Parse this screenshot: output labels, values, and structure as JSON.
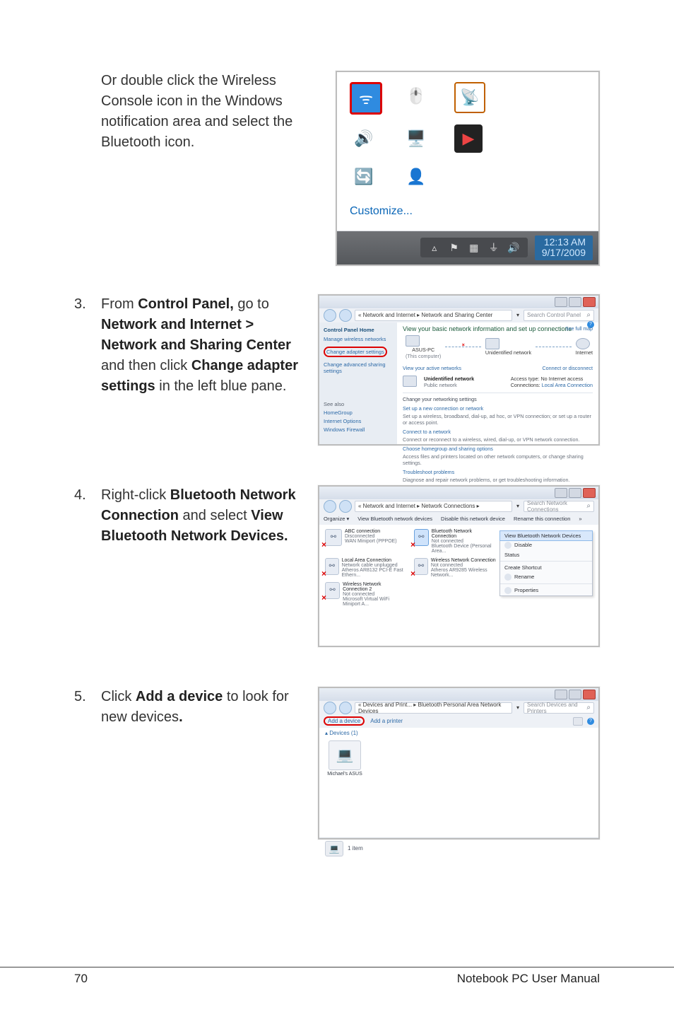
{
  "intro": {
    "text": "Or double click the Wireless Console icon in the Windows notification area and select the Bluetooth icon."
  },
  "steps": {
    "s3": {
      "num": "3.",
      "pre": "From ",
      "b1": "Control Panel,",
      "t1": " go to ",
      "b2": "Network and Internet > Network and Sharing Center",
      "t2": " and then click ",
      "b3": "Change adapter settings",
      "t3": " in the left blue pane."
    },
    "s4": {
      "num": "4.",
      "t0": "Right-click ",
      "b1": "Bluetooth Network Connection",
      "t1": " and select ",
      "b2": "View Bluetooth Network Devices."
    },
    "s5": {
      "num": "5.",
      "t0": "Click ",
      "b1": "Add a device",
      "t1": " to look for new devices",
      "b2": "."
    }
  },
  "shot1": {
    "customize": "Customize...",
    "time": "12:13 AM",
    "date": "9/17/2009",
    "icons": {
      "wifi": "wifi-icon",
      "mouse": "mouse-icon",
      "antenna": "antenna-icon",
      "speaker": "speaker-icon",
      "monitor": "monitor-icon",
      "video": "video-icon",
      "refresh": "refresh-icon",
      "user": "user-icon"
    },
    "tray": {
      "up": "▵",
      "flag": "⚑",
      "net": "▦",
      "bars": "⏚",
      "vol": "🔊"
    }
  },
  "shot2": {
    "breadcrumb": "« Network and Internet ▸ Network and Sharing Center",
    "search_ph": "Search Control Panel",
    "side_header": "Control Panel Home",
    "side_links": {
      "wireless": "Manage wireless networks",
      "adapter": "Change adapter settings",
      "sharing": "Change advanced sharing settings"
    },
    "see_also": "See also",
    "see_items": {
      "hg": "HomeGroup",
      "io": "Internet Options",
      "fw": "Windows Firewall"
    },
    "title": "View your basic network information and set up connections",
    "full_map": "See full map",
    "node1": "ASUS-PC",
    "node1b": "(This computer)",
    "node2": "Unidentified network",
    "node3": "Internet",
    "view_active": "View your active networks",
    "connect_dc": "Connect or disconnect",
    "unnet": "Unidentified network",
    "pubnet": "Public network",
    "acc_type_l": "Access type:",
    "acc_type_v": "No Internet access",
    "conn_l": "Connections:",
    "conn_v": "Local Area Connection",
    "change_hdr": "Change your networking settings",
    "setup_t": "Set up a new connection or network",
    "setup_d": "Set up a wireless, broadband, dial-up, ad hoc, or VPN connection; or set up a router or access point.",
    "connect_t": "Connect to a network",
    "connect_d": "Connect or reconnect to a wireless, wired, dial-up, or VPN network connection.",
    "home_t": "Choose homegroup and sharing options",
    "home_d": "Access files and printers located on other network computers, or change sharing settings.",
    "trouble_t": "Troubleshoot problems",
    "trouble_d": "Diagnose and repair network problems, or get troubleshooting information."
  },
  "shot3": {
    "breadcrumb": "« Network and Internet ▸ Network Connections ▸",
    "search_ph": "Search Network Connections",
    "tb": {
      "org": "Organize ▾",
      "view": "View Bluetooth network devices",
      "disable": "Disable this network device",
      "rename": "Rename this connection",
      "more": "»"
    },
    "conns": [
      {
        "n1": "ABC connection",
        "n2": "Disconnected",
        "n3": "WAN Miniport (PPPOE)",
        "x": true
      },
      {
        "n1": "Bluetooth Network Connection",
        "n2": "Not connected",
        "n3": "Bluetooth Device (Personal Area...",
        "x": true,
        "sel": true
      },
      {
        "n1": "Local Area Connection",
        "n2": "Network cable unplugged",
        "n3": "Atheros AR8132 PCI-E Fast Ethern...",
        "x": true
      },
      {
        "n1": "Wireless Network Connection",
        "n2": "Not connected",
        "n3": "Atheros AR9285 Wireless Network...",
        "x": true
      },
      {
        "n1": "Wireless Network Connection 2",
        "n2": "Not connected",
        "n3": "Microsoft Virtual WiFi Miniport A...",
        "x": true
      }
    ],
    "menu": {
      "view_bt": "View Bluetooth Network Devices",
      "disable": "Disable",
      "status": "Status",
      "shortcut": "Create Shortcut",
      "rename": "Rename",
      "props": "Properties"
    }
  },
  "shot4": {
    "breadcrumb": "« Devices and Print... ▸ Bluetooth Personal Area Network Devices",
    "search_ph": "Search Devices and Printers",
    "add_device": "Add a device",
    "add_printer": "Add a printer",
    "devices_hdr": "▴ Devices (1)",
    "device_name": "Michael's ASUS",
    "status": "1 item"
  },
  "footer": {
    "page": "70",
    "title": "Notebook PC User Manual"
  }
}
